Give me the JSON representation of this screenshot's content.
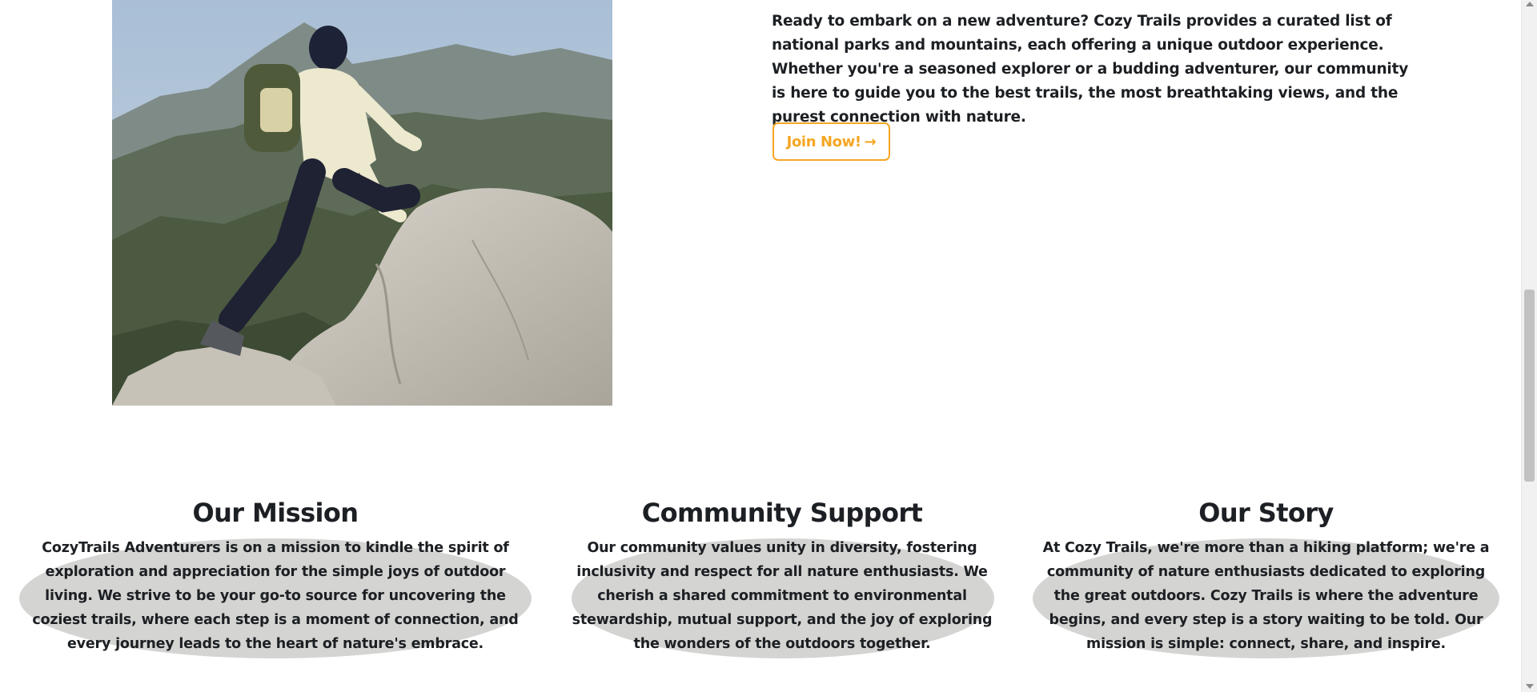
{
  "hero": {
    "photo_alt": "Hiker climbing a granite rock on a mountain",
    "intro_text": "Ready to embark on a new adventure? Cozy Trails provides a curated list of national parks and mountains, each offering a unique outdoor experience. Whether you're a seasoned explorer or a budding adventurer, our community is here to guide you to the best trails, the most breathtaking views, and the purest connection with nature.",
    "join_label": "Join Now!",
    "join_icon": "arrow-right-icon",
    "join_glyph": "→",
    "accent_color": "#f5a623"
  },
  "sections": [
    {
      "title": "Our Mission",
      "body": "CozyTrails Adventurers is on a mission to kindle the spirit of exploration and appreciation for the simple joys of outdoor living. We strive to be your go-to source for uncovering the coziest trails, where each step is a moment of connection, and every journey leads to the heart of nature's embrace."
    },
    {
      "title": "Community Support",
      "body": "Our community values unity in diversity, fostering inclusivity and respect for all nature enthusiasts. We cherish a shared commitment to environmental stewardship, mutual support, and the joy of exploring the wonders of the outdoors together."
    },
    {
      "title": "Our Story",
      "body": "At Cozy Trails, we're more than a hiking platform; we're a community of nature enthusiasts dedicated to exploring the great outdoors. Cozy Trails is where the adventure begins, and every step is a story waiting to be told. Our mission is simple: connect, share, and inspire."
    }
  ],
  "colors": {
    "text": "#1c1f23",
    "blob": "#d4d5d2",
    "background": "#ffffff"
  }
}
